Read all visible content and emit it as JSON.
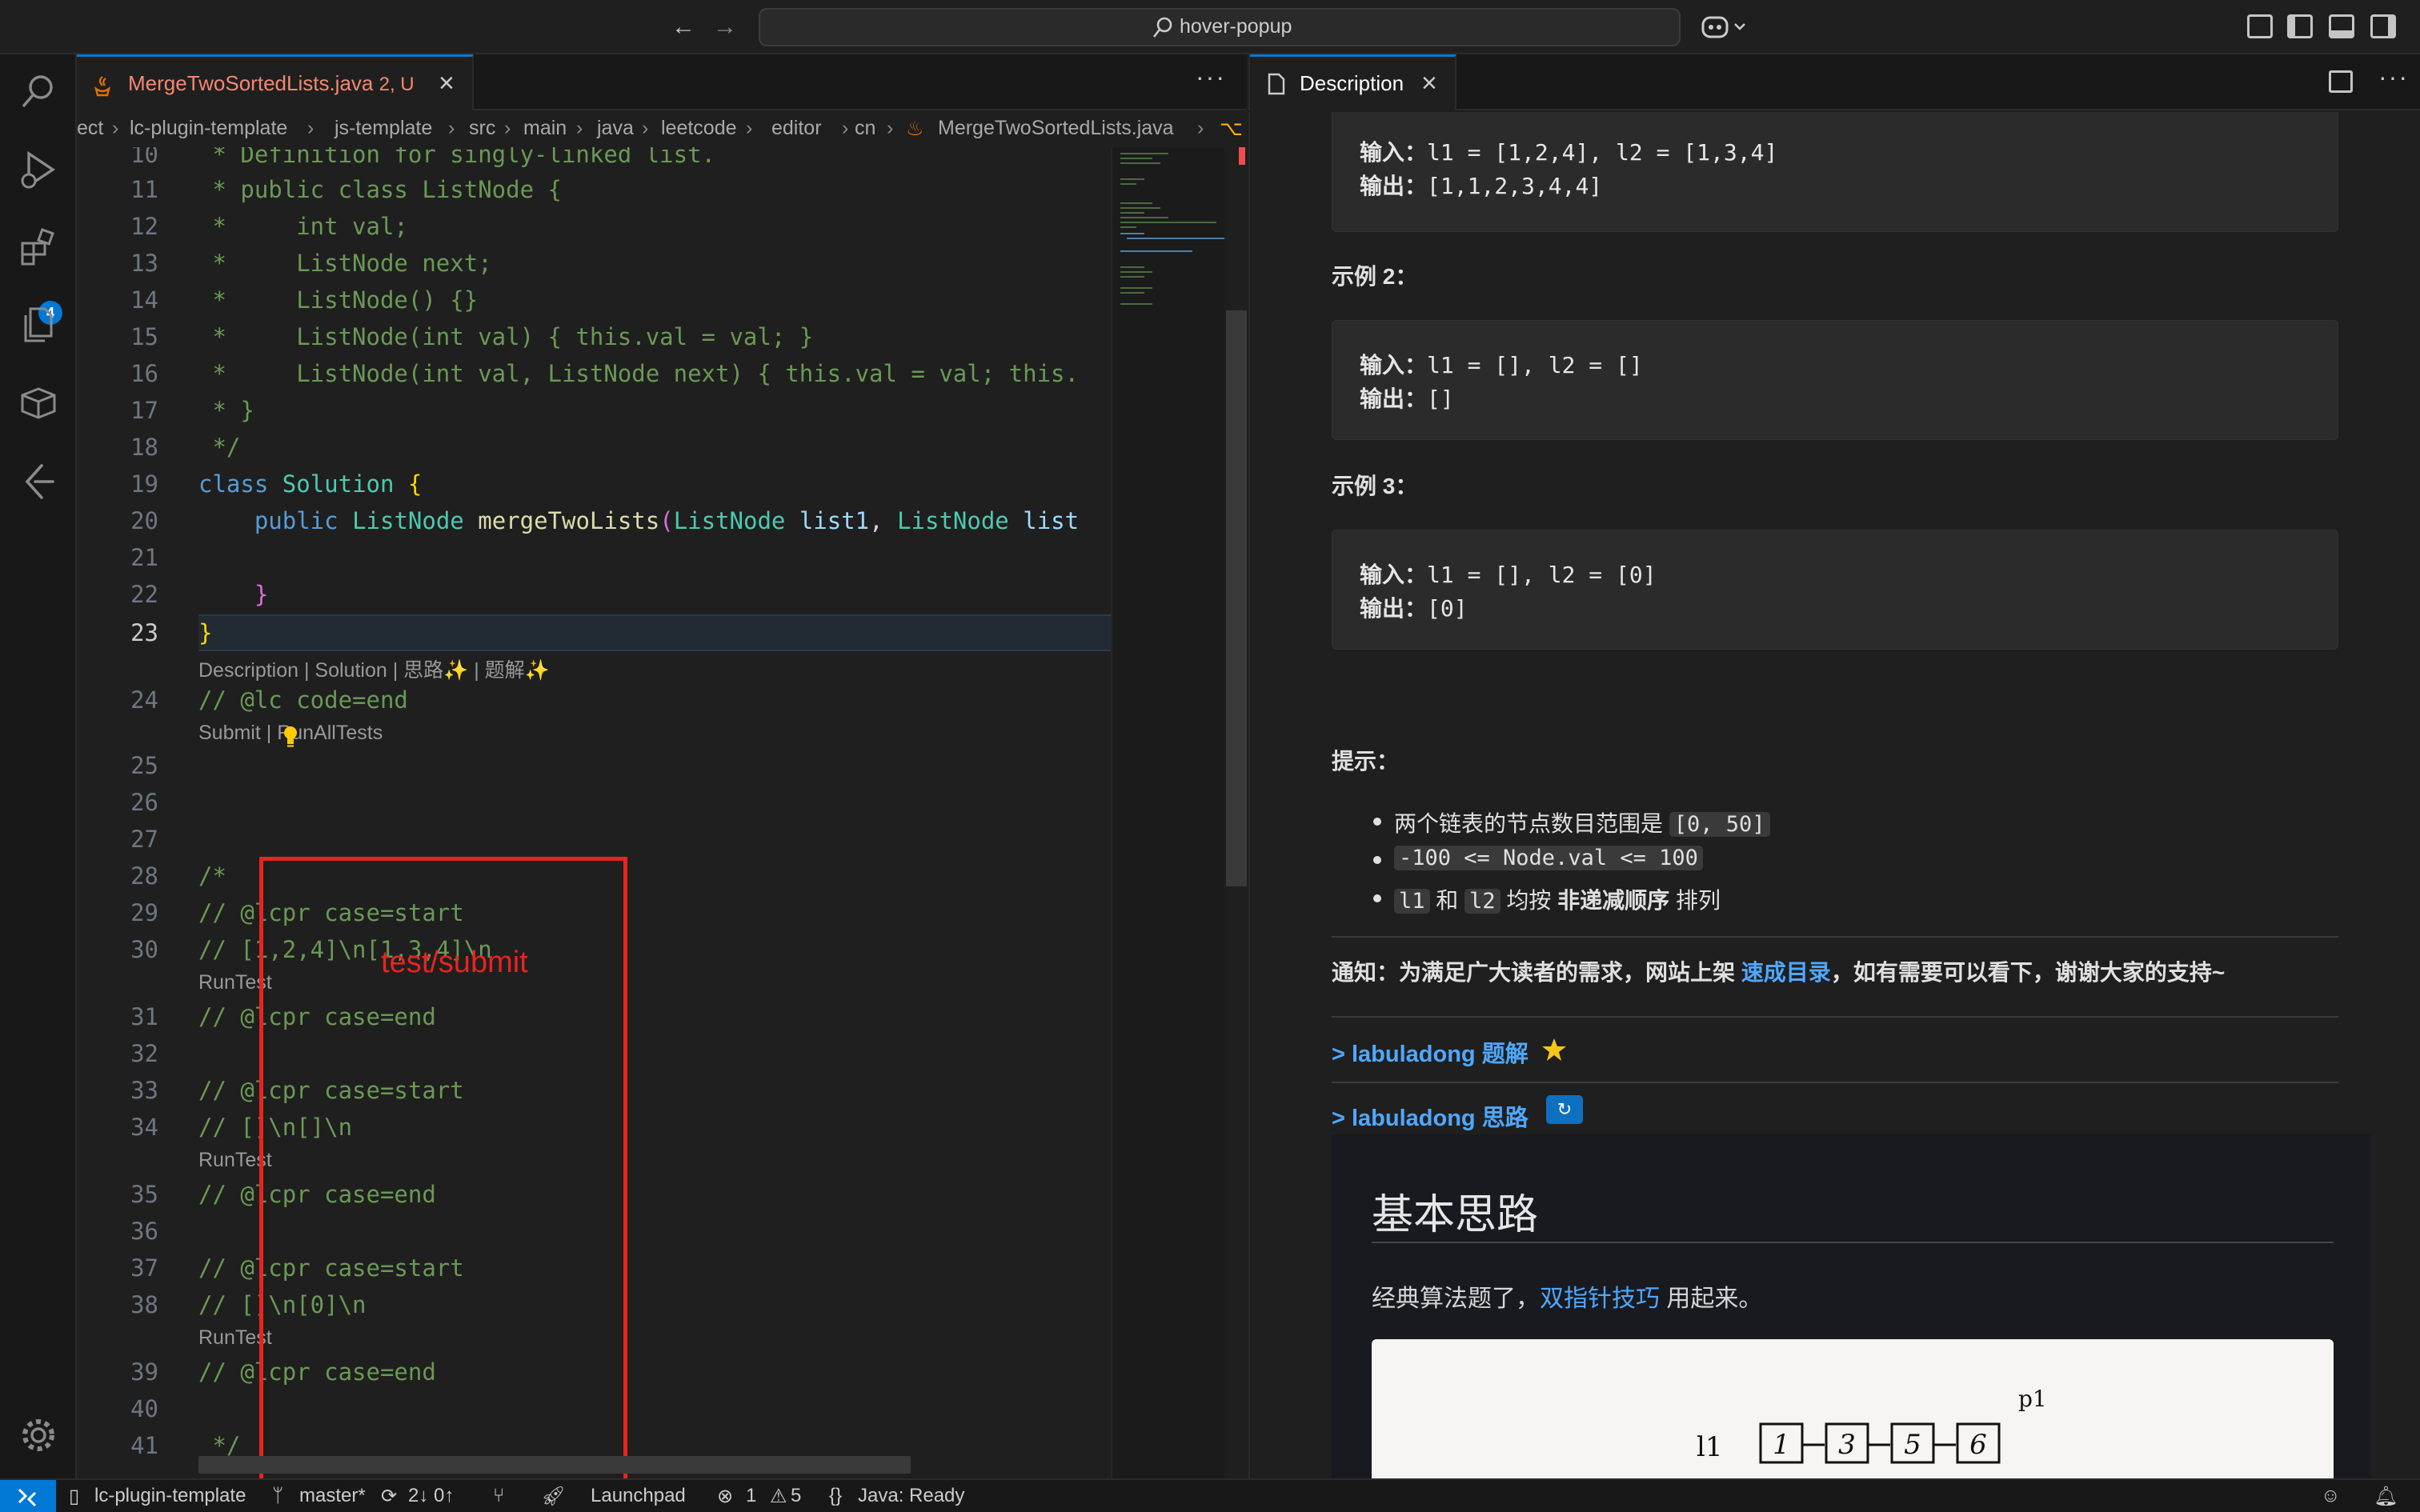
{
  "titlebar": {
    "search": "hover-popup"
  },
  "activity": {
    "extensions_badge": "4"
  },
  "editor": {
    "tab": {
      "filename": "MergeTwoSortedLists.java",
      "status": "2, U"
    },
    "breadcrumb": [
      "ect",
      "lc-plugin-template",
      "js-template",
      "src",
      "main",
      "java",
      "leetcode",
      "editor",
      "cn",
      "MergeTwoSortedLists.java"
    ],
    "lines": [
      {
        "n": "10",
        "text": " * Definition for singly-linked list."
      },
      {
        "n": "11",
        "text": " * public class ListNode {"
      },
      {
        "n": "12",
        "text": " *     int val;"
      },
      {
        "n": "13",
        "text": " *     ListNode next;"
      },
      {
        "n": "14",
        "text": " *     ListNode() {}"
      },
      {
        "n": "15",
        "text": " *     ListNode(int val) { this.val = val; }"
      },
      {
        "n": "16",
        "text": " *     ListNode(int val, ListNode next) { this.val = val; this."
      },
      {
        "n": "17",
        "text": " * }"
      },
      {
        "n": "18",
        "text": " */"
      },
      {
        "n": "19",
        "kw": "class",
        "name": "Solution",
        "rest": " {"
      },
      {
        "n": "20",
        "indent": "    ",
        "kw": "public",
        "type": "ListNode",
        "fn": "mergeTwoLists",
        "p1": "ListNode",
        "a1": "list1",
        "p2": "ListNode",
        "a2": "list"
      },
      {
        "n": "21",
        "text": ""
      },
      {
        "n": "22",
        "text": "    }"
      },
      {
        "n": "23",
        "text": "}"
      },
      {
        "n": "24",
        "text": "// @lc code=end"
      },
      {
        "n": "25",
        "text": ""
      },
      {
        "n": "26",
        "text": ""
      },
      {
        "n": "27",
        "text": ""
      },
      {
        "n": "28",
        "text": "/*"
      },
      {
        "n": "29",
        "text": "// @lcpr case=start"
      },
      {
        "n": "30",
        "text": "// [1,2,4]\\n[1,3,4]\\n"
      },
      {
        "n": "31",
        "text": "// @lcpr case=end"
      },
      {
        "n": "32",
        "text": ""
      },
      {
        "n": "33",
        "text": "// @lcpr case=start"
      },
      {
        "n": "34",
        "text": "// []\\n[]\\n"
      },
      {
        "n": "35",
        "text": "// @lcpr case=end"
      },
      {
        "n": "36",
        "text": ""
      },
      {
        "n": "37",
        "text": "// @lcpr case=start"
      },
      {
        "n": "38",
        "text": "// []\\n[0]\\n"
      },
      {
        "n": "39",
        "text": "// @lcpr case=end"
      },
      {
        "n": "40",
        "text": ""
      },
      {
        "n": "41",
        "text": " */"
      }
    ],
    "lens_top": "Description | Solution | 思路✨ | 题解✨",
    "lens_submit": "Submit | RunAllTests",
    "lens_runtest": "RunTest",
    "annotation": "test/submit"
  },
  "panel": {
    "tab": "Description",
    "examples": [
      {
        "heading": "",
        "input_label": "输入：",
        "input": "l1 = [1,2,4], l2 = [1,3,4]",
        "output_label": "输出：",
        "output": "[1,1,2,3,4,4]"
      },
      {
        "heading": "示例 2：",
        "input_label": "输入：",
        "input": "l1 = [], l2 = []",
        "output_label": "输出：",
        "output": "[]"
      },
      {
        "heading": "示例 3：",
        "input_label": "输入：",
        "input": "l1 = [], l2 = [0]",
        "output_label": "输出：",
        "output": "[0]"
      }
    ],
    "hints_title": "提示：",
    "hint1_text": "两个链表的节点数目范围是 ",
    "hint1_code": "[0, 50]",
    "hint2_code": "-100 <= Node.val <= 100",
    "hint3_code1": "l1",
    "hint3_mid": " 和 ",
    "hint3_code2": "l2",
    "hint3_text": " 均按 ",
    "hint3_bold": "非递减顺序",
    "hint3_tail": " 排列",
    "notice_pre": "通知：为满足广大读者的需求，网站上架 ",
    "notice_link": "速成目录",
    "notice_post": "，如有需要可以看下，谢谢大家的支持~",
    "details1": "> labuladong 题解",
    "details2": "> labuladong 思路",
    "solution_title": "基本思路",
    "solution_pre": "经典算法题了，",
    "solution_link": "双指针技巧",
    "solution_post": " 用起来。",
    "diagram": {
      "list_label": "l1",
      "nodes": [
        "1",
        "3",
        "5",
        "6"
      ],
      "pointer": "p1"
    }
  },
  "statusbar": {
    "project": "lc-plugin-template",
    "branch": "master*",
    "sync": "2↓ 0↑",
    "launchpad": "Launchpad",
    "errors": "1",
    "warnings": "5",
    "java": "Java: Ready"
  }
}
